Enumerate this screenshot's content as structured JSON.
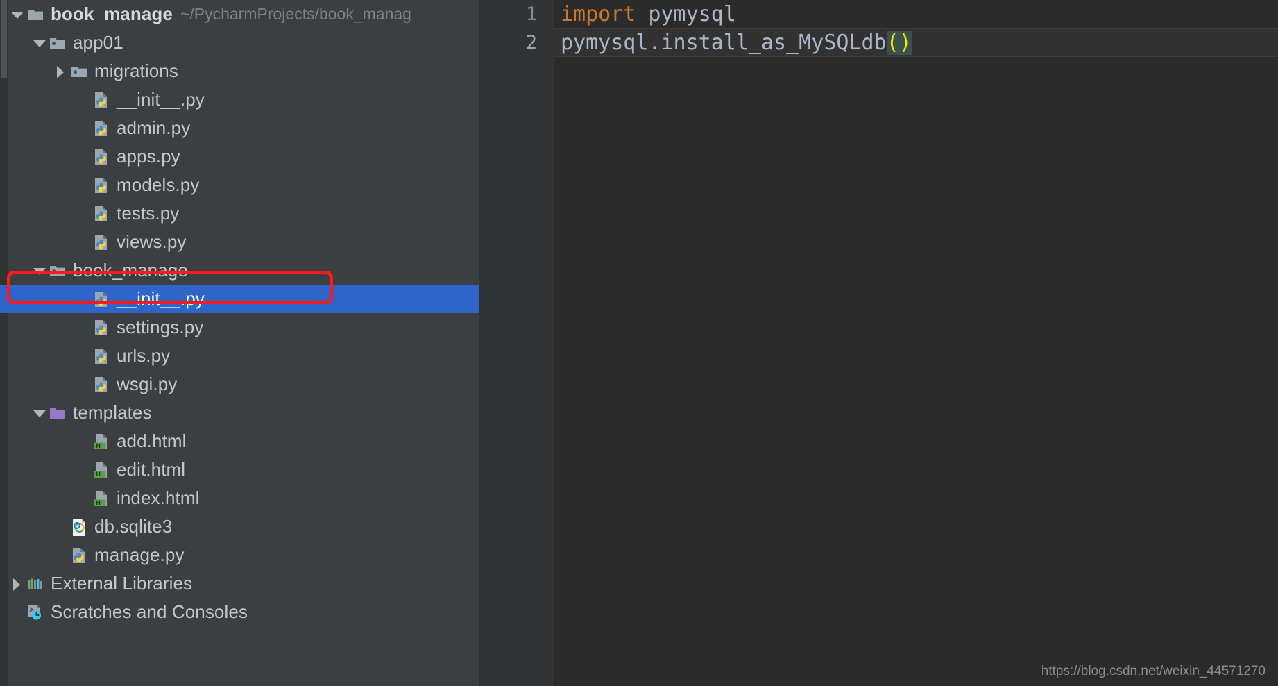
{
  "project_panel": {
    "scrollbar_name": "tree-vertical-scrollbar",
    "tree": [
      {
        "id": "book_manage-root",
        "label": "book_manage",
        "path_hint": "~/PycharmProjects/book_manag",
        "icon": "project-folder-icon",
        "twisty": "down",
        "indent": 0,
        "selected": false,
        "bold": true
      },
      {
        "id": "app01",
        "label": "app01",
        "path_hint": "",
        "icon": "module-folder-icon",
        "twisty": "down",
        "indent": 1,
        "selected": false,
        "bold": false
      },
      {
        "id": "migrations",
        "label": "migrations",
        "path_hint": "",
        "icon": "module-folder-icon",
        "twisty": "right",
        "indent": 2,
        "selected": false,
        "bold": false
      },
      {
        "id": "app01-init",
        "label": "__init__.py",
        "path_hint": "",
        "icon": "python-file-icon",
        "twisty": "none",
        "indent": 3,
        "selected": false,
        "bold": false
      },
      {
        "id": "admin",
        "label": "admin.py",
        "path_hint": "",
        "icon": "python-file-icon",
        "twisty": "none",
        "indent": 3,
        "selected": false,
        "bold": false
      },
      {
        "id": "apps",
        "label": "apps.py",
        "path_hint": "",
        "icon": "python-file-icon",
        "twisty": "none",
        "indent": 3,
        "selected": false,
        "bold": false
      },
      {
        "id": "models",
        "label": "models.py",
        "path_hint": "",
        "icon": "python-file-icon",
        "twisty": "none",
        "indent": 3,
        "selected": false,
        "bold": false
      },
      {
        "id": "tests",
        "label": "tests.py",
        "path_hint": "",
        "icon": "python-file-icon",
        "twisty": "none",
        "indent": 3,
        "selected": false,
        "bold": false
      },
      {
        "id": "views",
        "label": "views.py",
        "path_hint": "",
        "icon": "python-file-icon",
        "twisty": "none",
        "indent": 3,
        "selected": false,
        "bold": false
      },
      {
        "id": "book_manage-pkg",
        "label": "book_manage",
        "path_hint": "",
        "icon": "module-folder-icon",
        "twisty": "down",
        "indent": 1,
        "selected": false,
        "bold": false
      },
      {
        "id": "pkg-init",
        "label": "__init__.py",
        "path_hint": "",
        "icon": "python-file-icon",
        "twisty": "none",
        "indent": 3,
        "selected": true,
        "bold": false
      },
      {
        "id": "settings",
        "label": "settings.py",
        "path_hint": "",
        "icon": "python-file-icon",
        "twisty": "none",
        "indent": 3,
        "selected": false,
        "bold": false
      },
      {
        "id": "urls",
        "label": "urls.py",
        "path_hint": "",
        "icon": "python-file-icon",
        "twisty": "none",
        "indent": 3,
        "selected": false,
        "bold": false
      },
      {
        "id": "wsgi",
        "label": "wsgi.py",
        "path_hint": "",
        "icon": "python-file-icon",
        "twisty": "none",
        "indent": 3,
        "selected": false,
        "bold": false
      },
      {
        "id": "templates",
        "label": "templates",
        "path_hint": "",
        "icon": "templates-folder-icon",
        "twisty": "down",
        "indent": 1,
        "selected": false,
        "bold": false
      },
      {
        "id": "add-html",
        "label": "add.html",
        "path_hint": "",
        "icon": "html-file-icon",
        "twisty": "none",
        "indent": 3,
        "selected": false,
        "bold": false
      },
      {
        "id": "edit-html",
        "label": "edit.html",
        "path_hint": "",
        "icon": "html-file-icon",
        "twisty": "none",
        "indent": 3,
        "selected": false,
        "bold": false
      },
      {
        "id": "index-html",
        "label": "index.html",
        "path_hint": "",
        "icon": "html-file-icon",
        "twisty": "none",
        "indent": 3,
        "selected": false,
        "bold": false
      },
      {
        "id": "db-sqlite3",
        "label": "db.sqlite3",
        "path_hint": "",
        "icon": "sqlite-file-icon",
        "twisty": "none",
        "indent": 2,
        "selected": false,
        "bold": false
      },
      {
        "id": "manage-py",
        "label": "manage.py",
        "path_hint": "",
        "icon": "python-file-icon",
        "twisty": "none",
        "indent": 2,
        "selected": false,
        "bold": false
      },
      {
        "id": "external-libraries",
        "label": "External Libraries",
        "path_hint": "",
        "icon": "external-libraries-icon",
        "twisty": "right",
        "indent": 0,
        "selected": false,
        "bold": false
      },
      {
        "id": "scratches-and-consoles",
        "label": "Scratches and Consoles",
        "path_hint": "",
        "icon": "scratches-icon",
        "twisty": "none",
        "indent": 0,
        "selected": false,
        "bold": false
      }
    ]
  },
  "editor": {
    "gutter": {
      "line1": "1",
      "line2": "2"
    },
    "code": {
      "line1_keyword": "import",
      "line1_rest": " pymysql",
      "line2_text": "pymysql.install_as_MySQLdb",
      "line2_brackets": "()"
    }
  },
  "annotation": {
    "name": "red-highlight-box",
    "color": "#fb1b1b"
  },
  "watermark": {
    "text": "https://blog.csdn.net/weixin_44571270"
  },
  "colors": {
    "panel_bg": "#3c3f41",
    "editor_bg": "#2b2b2b",
    "gutter_bg": "#313335",
    "selection_blue": "#2f65ca",
    "keyword_orange": "#cc7832",
    "bracket_yellow": "#ffe400",
    "annotation_red": "#fb1b1b"
  }
}
